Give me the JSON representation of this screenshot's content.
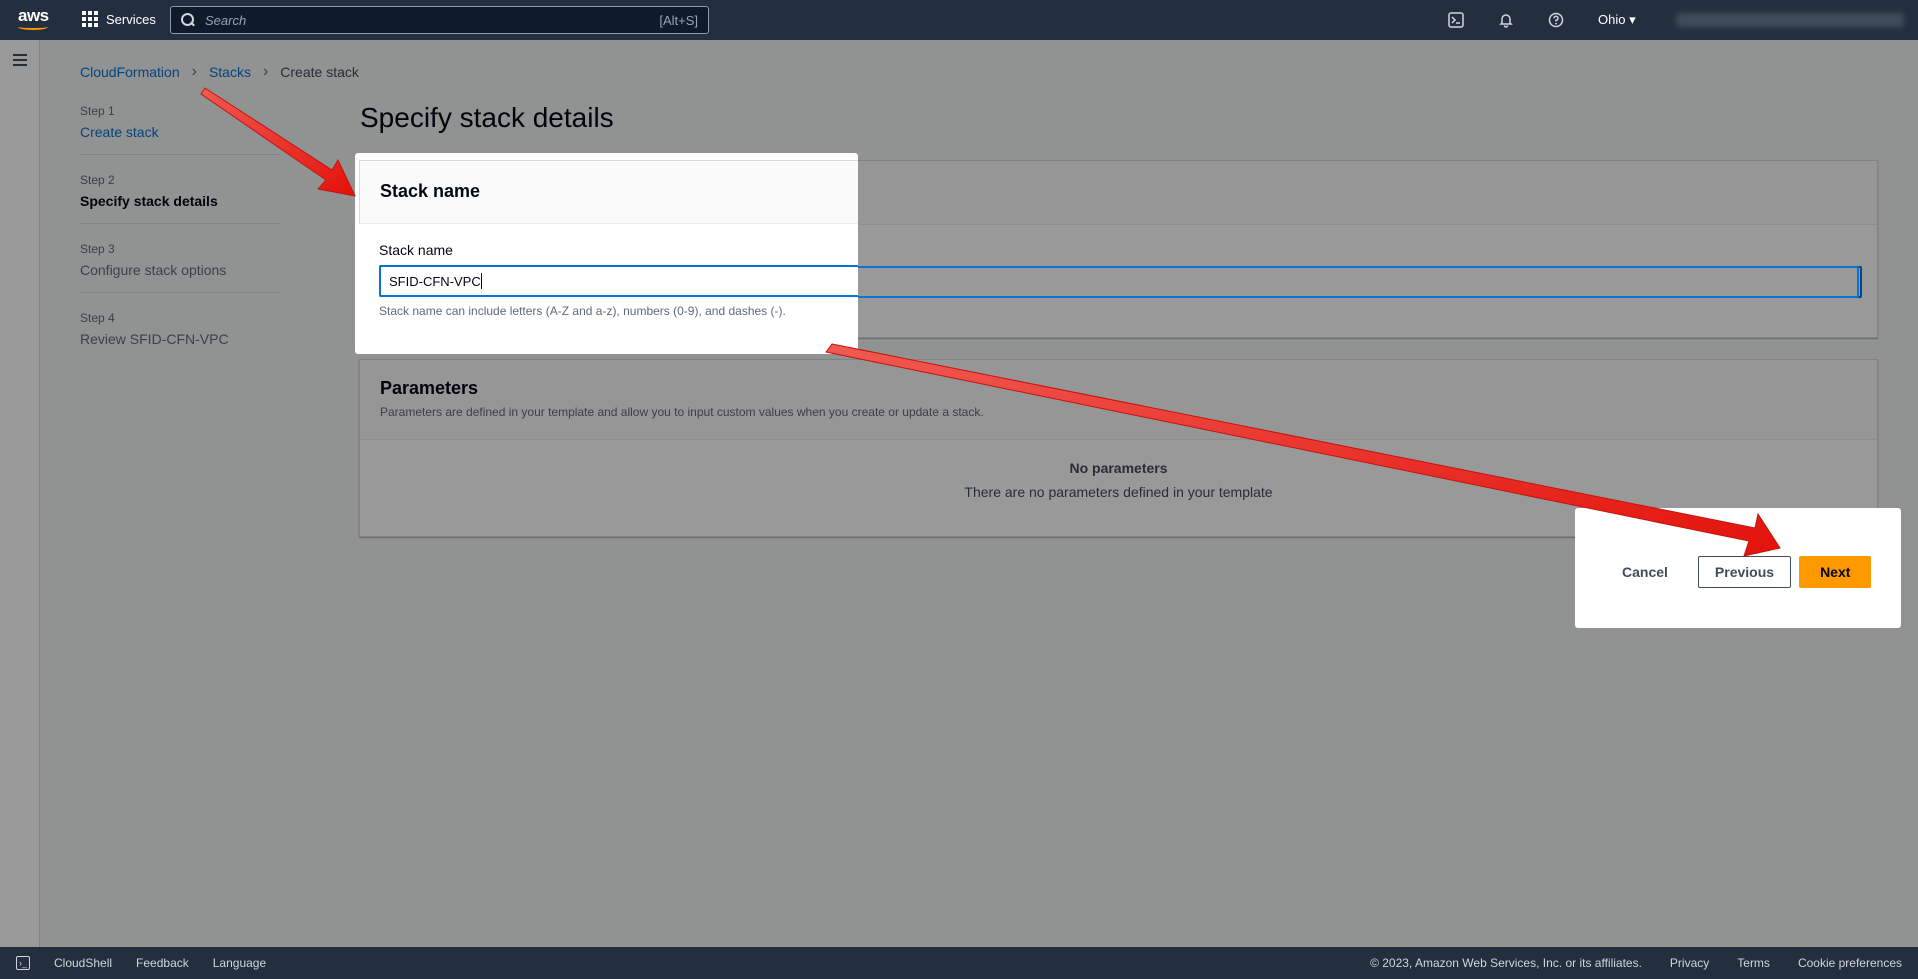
{
  "topnav": {
    "logo": "aws",
    "services_label": "Services",
    "search_placeholder": "Search",
    "search_shortcut": "[Alt+S]",
    "region": "Ohio ▾",
    "icons": [
      "cloudshell-icon",
      "bell-icon",
      "help-icon"
    ]
  },
  "breadcrumb": {
    "items": [
      "CloudFormation",
      "Stacks"
    ],
    "current": "Create stack"
  },
  "steps": [
    {
      "num": "Step 1",
      "label": "Create stack"
    },
    {
      "num": "Step 2",
      "label": "Specify stack details"
    },
    {
      "num": "Step 3",
      "label": "Configure stack options"
    },
    {
      "num": "Step 4",
      "label": "Review SFID-CFN-VPC"
    }
  ],
  "page_title": "Specify stack details",
  "stack_name": {
    "header": "Stack name",
    "field_label": "Stack name",
    "value": "SFID-CFN-VPC",
    "hint": "Stack name can include letters (A-Z and a-z), numbers (0-9), and dashes (-)."
  },
  "parameters": {
    "header": "Parameters",
    "description": "Parameters are defined in your template and allow you to input custom values when you create or update a stack.",
    "empty_title": "No parameters",
    "empty_desc": "There are no parameters defined in your template"
  },
  "actions": {
    "cancel": "Cancel",
    "previous": "Previous",
    "next": "Next"
  },
  "footer": {
    "cloudshell": "CloudShell",
    "feedback": "Feedback",
    "language": "Language",
    "copyright": "© 2023, Amazon Web Services, Inc. or its affiliates.",
    "privacy": "Privacy",
    "terms": "Terms",
    "cookies": "Cookie preferences"
  },
  "colors": {
    "nav_bg": "#232f3e",
    "accent": "#ff9900",
    "link": "#0972d3",
    "annotation_arrow": "#e8201d"
  }
}
